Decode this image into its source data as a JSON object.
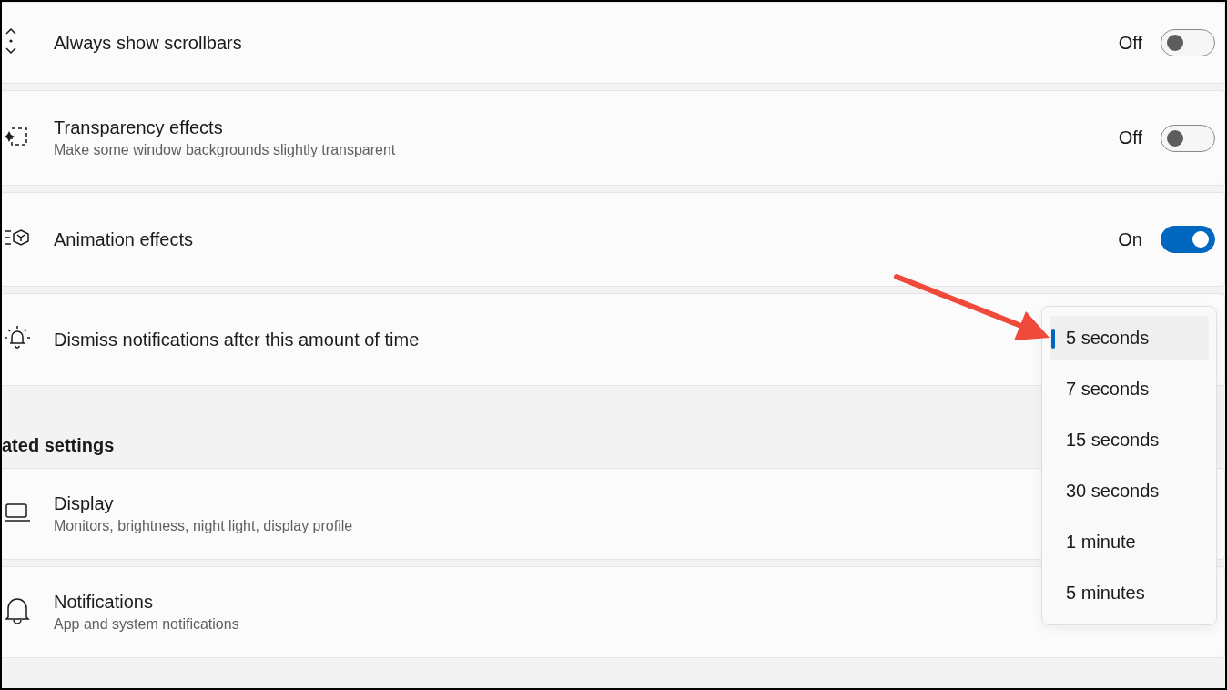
{
  "settings": [
    {
      "kind": "toggle",
      "title": "Always show scrollbars",
      "state_label": "Off",
      "on": false
    },
    {
      "kind": "toggle",
      "title": "Transparency effects",
      "subtitle": "Make some window backgrounds slightly transparent",
      "state_label": "Off",
      "on": false
    },
    {
      "kind": "toggle",
      "title": "Animation effects",
      "state_label": "On",
      "on": true
    },
    {
      "kind": "dropdown",
      "title": "Dismiss notifications after this amount of time"
    }
  ],
  "dropdown": {
    "options": [
      {
        "label": "5 seconds",
        "selected": true
      },
      {
        "label": "7 seconds",
        "selected": false
      },
      {
        "label": "15 seconds",
        "selected": false
      },
      {
        "label": "30 seconds",
        "selected": false
      },
      {
        "label": "1 minute",
        "selected": false
      },
      {
        "label": "5 minutes",
        "selected": false
      }
    ]
  },
  "related": {
    "heading": "ated settings",
    "items": [
      {
        "title": "Display",
        "subtitle": "Monitors, brightness, night light, display profile"
      },
      {
        "title": "Notifications",
        "subtitle": "App and system notifications"
      }
    ]
  }
}
